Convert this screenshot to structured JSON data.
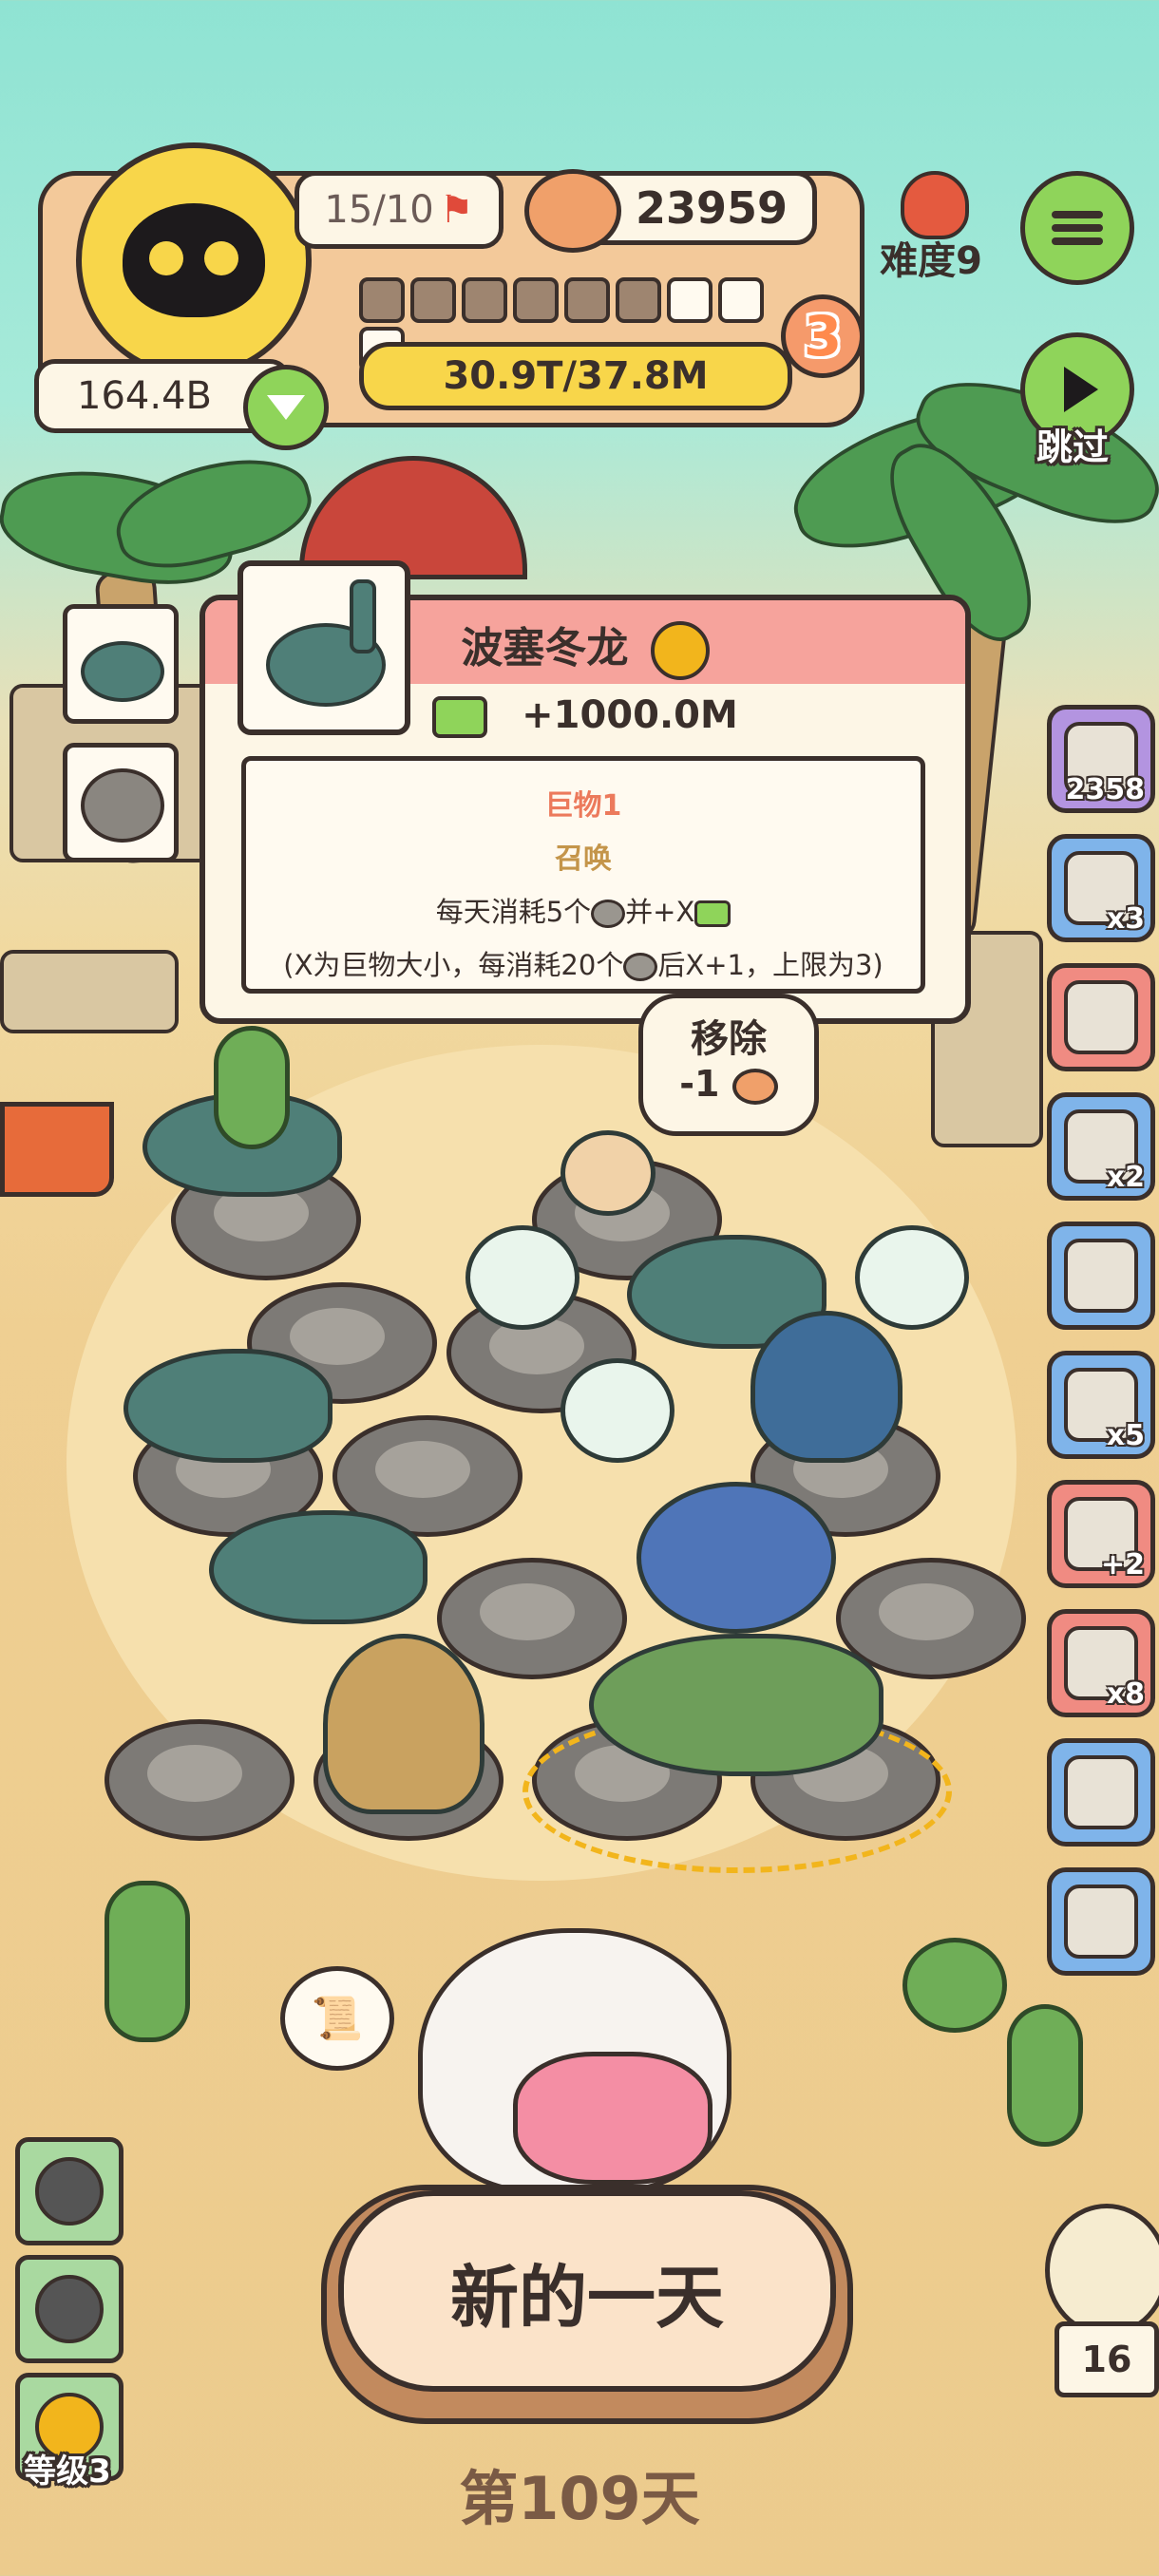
{
  "header": {
    "avatar_icon": "black-cat-avatar-icon",
    "flag_count": "15/10",
    "coins": "23959",
    "money_total": "164.4B",
    "progress_text": "30.9T/37.8M",
    "progress_segments_total": 9,
    "progress_segments_filled": 6,
    "level_badge": "3",
    "difficulty_label": "难度9",
    "skip_label": "跳过",
    "colors": {
      "accent_orange": "#f0a06a",
      "progress_yellow": "#f8d64a",
      "menu_green": "#8fd45a"
    }
  },
  "popup": {
    "title": "波塞冬龙",
    "income": "+1000.0M",
    "trait_label": "巨物1",
    "ability_label": "召唤",
    "desc_line1": "每天消耗5个",
    "desc_line1_mid": "并+X",
    "desc_line2a": "(X为巨物大小，每消耗20个",
    "desc_line2b": "后X+1，上限为3)"
  },
  "remove_bubble": {
    "label": "移除",
    "cost": "-1"
  },
  "side_items": [
    {
      "icon": "egg-stone-icon",
      "count": "2358",
      "color": "#b394e0"
    },
    {
      "icon": "plant-tag-icon",
      "count": "x3",
      "color": "#7fb4ea"
    },
    {
      "icon": "green-potion-icon",
      "count": "",
      "color": "#f08b82"
    },
    {
      "icon": "tin-can-icon",
      "count": "x2",
      "color": "#7fb4ea"
    },
    {
      "icon": "jar-icon",
      "count": "",
      "color": "#7fb4ea"
    },
    {
      "icon": "donut-icon",
      "count": "x5",
      "color": "#7fb4ea"
    },
    {
      "icon": "egg-plus-icon",
      "count": "+2",
      "color": "#f08b82"
    },
    {
      "icon": "bomb-icon",
      "count": "x8",
      "color": "#f08b82"
    },
    {
      "icon": "pot-icon",
      "count": "",
      "color": "#7fb4ea"
    },
    {
      "icon": "camera-icon",
      "count": "",
      "color": "#7fb4ea"
    }
  ],
  "left_items": [
    {
      "icon": "brachiosaurus-icon"
    },
    {
      "icon": "stone-egg-icon"
    }
  ],
  "bottom": {
    "new_day_label": "新的一天",
    "day_label": "第109天",
    "level_label": "等级3",
    "owl_count": "16"
  }
}
